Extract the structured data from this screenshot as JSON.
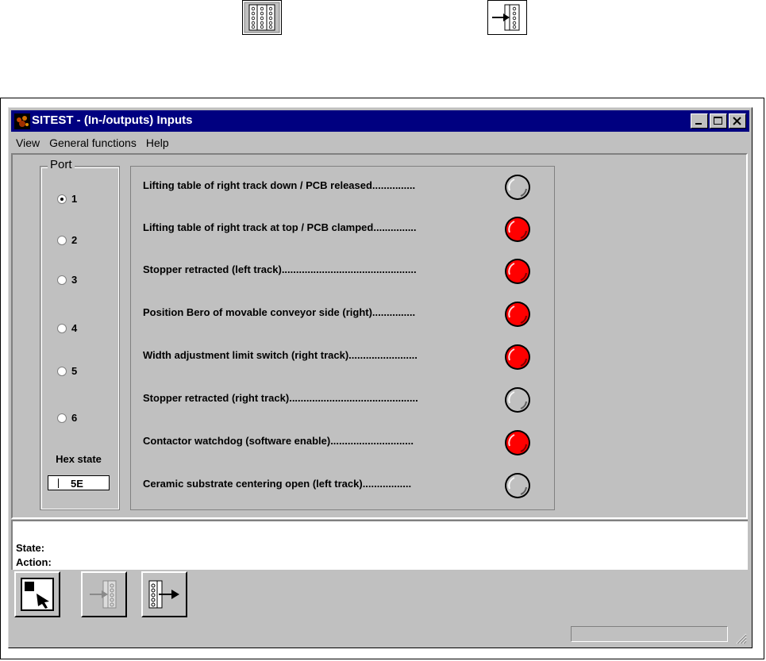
{
  "top_icons": [
    {
      "icon": "inputs-panel-icon"
    },
    {
      "icon": "set-inputs-arrow-icon"
    }
  ],
  "window": {
    "title": "SITEST  - (In-/outputs) Inputs",
    "controls": [
      "minimize",
      "maximize",
      "close"
    ]
  },
  "menu": {
    "items": [
      "View",
      "General functions",
      "Help"
    ]
  },
  "port": {
    "legend": "Port",
    "options": [
      "1",
      "2",
      "3",
      "4",
      "5",
      "6"
    ],
    "selected": "1",
    "hex_label": "Hex state",
    "hex_value": "5E"
  },
  "inputs": [
    {
      "label": "Lifting table of right track down / PCB released...............",
      "state": "off"
    },
    {
      "label": "Lifting table of right track at top / PCB clamped...............",
      "state": "on"
    },
    {
      "label": "Stopper retracted (left track)...............................................",
      "state": "on"
    },
    {
      "label": "Position Bero of movable conveyor side (right)...............",
      "state": "on"
    },
    {
      "label": "Width adjustment limit switch (right track)........................",
      "state": "on"
    },
    {
      "label": "Stopper retracted (right track).............................................",
      "state": "off"
    },
    {
      "label": "Contactor watchdog (software enable).............................",
      "state": "on"
    },
    {
      "label": "Ceramic substrate centering open (left track).................",
      "state": "off"
    }
  ],
  "status": {
    "state_label": "State:",
    "action_label": "Action:"
  },
  "toolbar": {
    "buttons": [
      {
        "icon": "select-pointer-icon",
        "enabled": true
      },
      {
        "icon": "set-inputs-arrow-icon",
        "enabled": false
      },
      {
        "icon": "outputs-arrow-icon",
        "enabled": true
      }
    ]
  },
  "colors": {
    "titlebar": "#000080",
    "led_on": "#ff0000",
    "led_off": "#c0c0c0",
    "face": "#c0c0c0"
  }
}
